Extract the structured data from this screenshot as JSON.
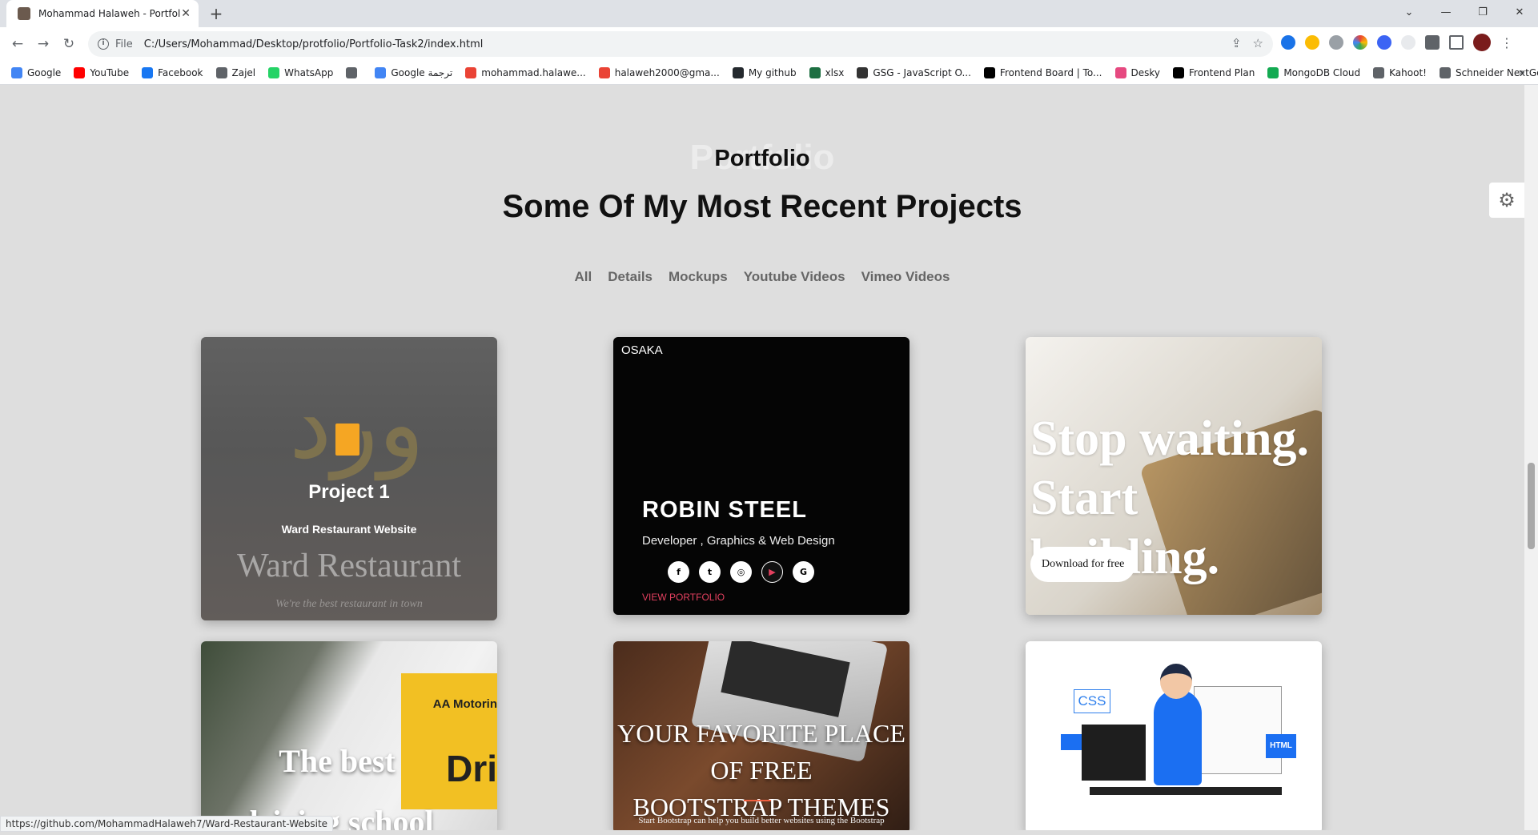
{
  "browser": {
    "tab_title": "Mohammad Halaweh - Portfolio",
    "url_scheme": "File",
    "url": "C:/Users/Mohammad/Desktop/protfolio/Portfolio-Task2/index.html",
    "status_url": "https://github.com/MohammadHalaweh7/Ward-Restaurant-Website",
    "bookmarks": [
      {
        "label": "Google",
        "color": "#4285f4"
      },
      {
        "label": "YouTube",
        "color": "#ff0000"
      },
      {
        "label": "Facebook",
        "color": "#1877f2"
      },
      {
        "label": "Zajel",
        "color": "#5f6368"
      },
      {
        "label": "WhatsApp",
        "color": "#25d366"
      },
      {
        "label": "",
        "color": "#5f6368"
      },
      {
        "label": "Google ترجمة",
        "color": "#4285f4"
      },
      {
        "label": "mohammad.halawe...",
        "color": "#ea4335"
      },
      {
        "label": "halaweh2000@gma...",
        "color": "#ea4335"
      },
      {
        "label": "My github",
        "color": "#24292e"
      },
      {
        "label": "xlsx",
        "color": "#1d6f42"
      },
      {
        "label": "GSG - JavaScript O...",
        "color": "#333333"
      },
      {
        "label": "Frontend Board | To...",
        "color": "#000000"
      },
      {
        "label": "Desky",
        "color": "#e64980"
      },
      {
        "label": "Frontend Plan",
        "color": "#000000"
      },
      {
        "label": "MongoDB Cloud",
        "color": "#13aa52"
      },
      {
        "label": "Kahoot!",
        "color": "#5f6368"
      },
      {
        "label": "Schneider NextGen...",
        "color": "#5f6368"
      }
    ]
  },
  "section": {
    "ghost": "Portfolio",
    "title": "Portfolio",
    "subtitle": "Some Of My Most Recent Projects",
    "filters": [
      "All",
      "Details",
      "Mockups",
      "Youtube Videos",
      "Vimeo Videos"
    ]
  },
  "cards": {
    "c1": {
      "title": "Project 1",
      "subtitle": "Ward Restaurant Website",
      "bg_name": "Ward Restaurant",
      "bg_tag": "We're the best restaurant in town",
      "arabic": "ورد"
    },
    "c2": {
      "brand": "OSAKA",
      "name": "ROBIN STEEL",
      "role": "Developer , Graphics & Web Design",
      "socials": [
        "f",
        "t",
        "◎",
        "▶",
        "G"
      ],
      "cta": "VIEW PORTFOLIO"
    },
    "c3": {
      "headline_1": "Stop waiting.",
      "headline_2": "Start building.",
      "button": "Download for free"
    },
    "c4": {
      "line_1": "The best",
      "line_2": "driving school",
      "badge": "AA Motorin",
      "side": "Dri"
    },
    "c5": {
      "line_1": "YOUR FAVORITE PLACE OF FREE",
      "line_2": "BOOTSTRAP THEMES",
      "small": "Start Bootstrap can help you build better websites using the Bootstrap"
    },
    "c6": {
      "css": "CSS",
      "html": "HTML"
    }
  }
}
